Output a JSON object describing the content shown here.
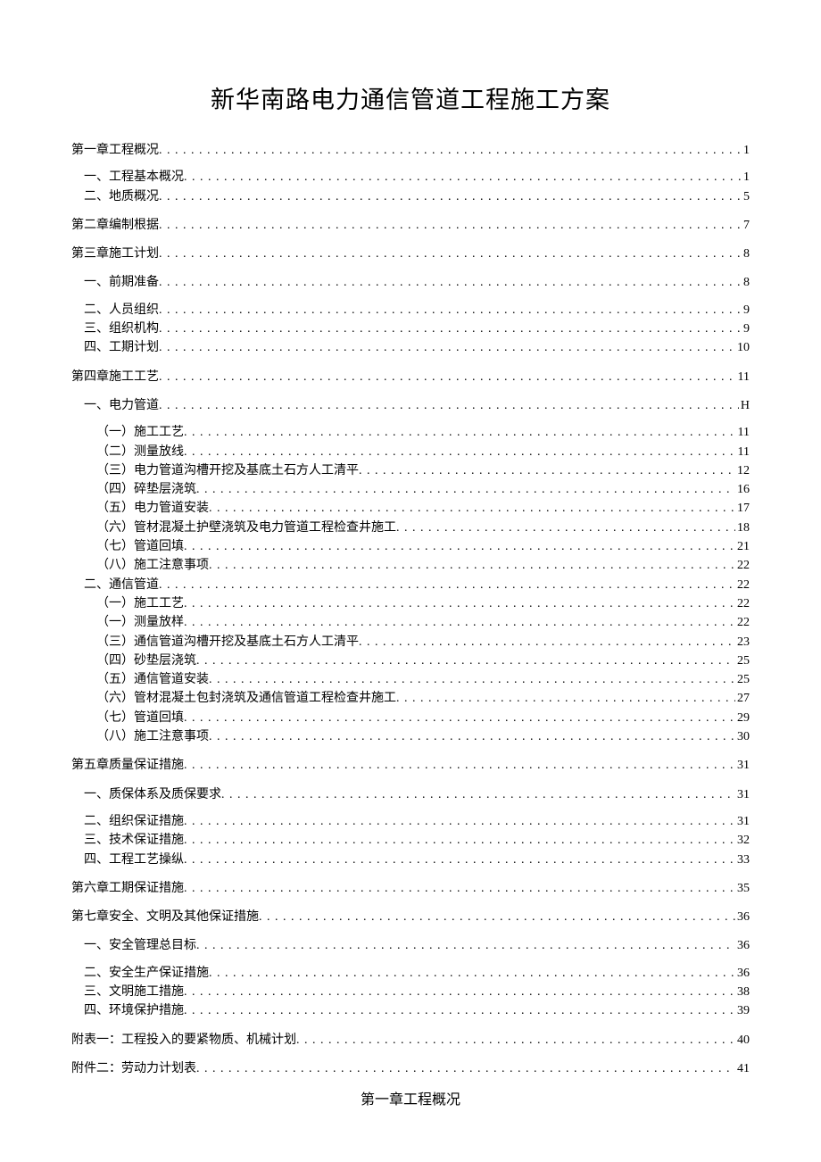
{
  "title": "新华南路电力通信管道工程施工方案",
  "toc": [
    {
      "label": "第一章工程概况",
      "page": "1",
      "level": 0,
      "gap": true
    },
    {
      "label": "一、工程基本概况",
      "page": "1",
      "level": 1
    },
    {
      "label": "二、地质概况",
      "page": "5",
      "level": 1
    },
    {
      "label": "第二章编制根据",
      "page": "7",
      "level": 0,
      "gap": true
    },
    {
      "label": "第三章施工计划",
      "page": "8",
      "level": 0,
      "gap": true
    },
    {
      "label": "一、前期准备",
      "page": "8",
      "level": 1,
      "gap": true
    },
    {
      "label": "二、人员组织",
      "page": "9",
      "level": 1
    },
    {
      "label": "三、组织机构",
      "page": "9",
      "level": 1
    },
    {
      "label": "四、工期计划",
      "page": "10",
      "level": 1
    },
    {
      "label": "第四章施工工艺",
      "page": "11",
      "level": 0,
      "gap": true
    },
    {
      "label": "一、电力管道",
      "page": "H",
      "level": 1,
      "gap": true
    },
    {
      "label": "（一）施工工艺",
      "page": "11",
      "level": 2
    },
    {
      "label": "（二）测量放线",
      "page": "11",
      "level": 2
    },
    {
      "label": "（三）电力管道沟槽开挖及基底土石方人工清平",
      "page": "12",
      "level": 2
    },
    {
      "label": "（四）碎垫层浇筑",
      "page": "16",
      "level": 2
    },
    {
      "label": "（五）电力管道安装",
      "page": "17",
      "level": 2
    },
    {
      "label": "（六）管材混凝土护壁浇筑及电力管道工程检查井施工",
      "page": "18",
      "level": 2
    },
    {
      "label": "（七）管道回填",
      "page": "21",
      "level": 2
    },
    {
      "label": "（八）施工注意事项",
      "page": "22",
      "level": 2
    },
    {
      "label": "二、通信管道",
      "page": "22",
      "level": 1
    },
    {
      "label": "（一）施工工艺",
      "page": "22",
      "level": 2
    },
    {
      "label": "（一）测量放样",
      "page": "22",
      "level": 2
    },
    {
      "label": "（三）通信管道沟槽开挖及基底土石方人工清平",
      "page": "23",
      "level": 2
    },
    {
      "label": "（四）砂垫层浇筑",
      "page": "25",
      "level": 2
    },
    {
      "label": "（五）通信管道安装",
      "page": "25",
      "level": 2
    },
    {
      "label": "（六）管材混凝土包封浇筑及通信管道工程检查井施工",
      "page": "27",
      "level": 2
    },
    {
      "label": "（七）管道回填",
      "page": "29",
      "level": 2
    },
    {
      "label": "（八）施工注意事项",
      "page": "30",
      "level": 2
    },
    {
      "label": "第五章质量保证措施",
      "page": "31",
      "level": 0,
      "gap": true
    },
    {
      "label": "一、质保体系及质保要求",
      "page": "31",
      "level": 1,
      "gap": true
    },
    {
      "label": "二、组织保证措施",
      "page": "31",
      "level": 1
    },
    {
      "label": "三、技术保证措施",
      "page": "32",
      "level": 1
    },
    {
      "label": "四、工程工艺操纵",
      "page": "33",
      "level": 1
    },
    {
      "label": "第六章工期保证措施",
      "page": "35",
      "level": 0,
      "gap": true
    },
    {
      "label": "第七章安全、文明及其他保证措施",
      "page": "36",
      "level": 0,
      "gap": true
    },
    {
      "label": "一、安全管理总目标",
      "page": "36",
      "level": 1,
      "gap": true
    },
    {
      "label": "二、安全生产保证措施",
      "page": "36",
      "level": 1
    },
    {
      "label": "三、文明施工措施",
      "page": "38",
      "level": 1
    },
    {
      "label": "四、环境保护措施",
      "page": "39",
      "level": 1
    },
    {
      "label": "附表一：工程投入的要紧物质、机械计划",
      "page": "40",
      "level": 0,
      "gap": true
    },
    {
      "label": "附件二：劳动力计划表",
      "page": "41",
      "level": 0,
      "gap": true
    }
  ],
  "chapter_heading": "第一章工程概况"
}
